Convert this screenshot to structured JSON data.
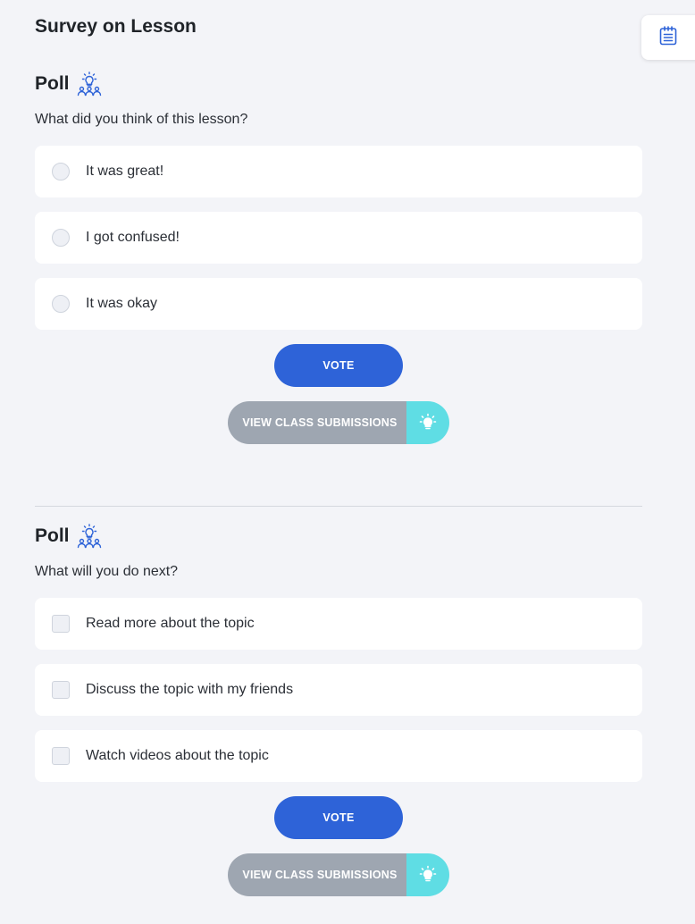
{
  "page": {
    "title": "Survey on Lesson"
  },
  "notes_button": {
    "icon": "notepad-icon"
  },
  "polls": [
    {
      "title": "Poll",
      "icon": "poll-people-icon",
      "question": "What did you think of this lesson?",
      "input_type": "radio",
      "options": [
        {
          "label": "It was great!"
        },
        {
          "label": "I got confused!"
        },
        {
          "label": "It was okay"
        }
      ],
      "vote_label": "VOTE",
      "submissions_label": "VIEW CLASS SUBMISSIONS",
      "submissions_icon": "lightbulb-icon"
    },
    {
      "title": "Poll",
      "icon": "poll-people-icon",
      "question": "What will you do next?",
      "input_type": "checkbox",
      "options": [
        {
          "label": "Read more about the topic"
        },
        {
          "label": "Discuss the topic with my friends"
        },
        {
          "label": "Watch videos about the topic"
        }
      ],
      "vote_label": "VOTE",
      "submissions_label": "VIEW CLASS SUBMISSIONS",
      "submissions_icon": "lightbulb-icon"
    }
  ],
  "colors": {
    "background": "#f3f4f8",
    "primary": "#2e63d8",
    "secondary_button": "#9ea6b1",
    "accent": "#5fdde4"
  }
}
